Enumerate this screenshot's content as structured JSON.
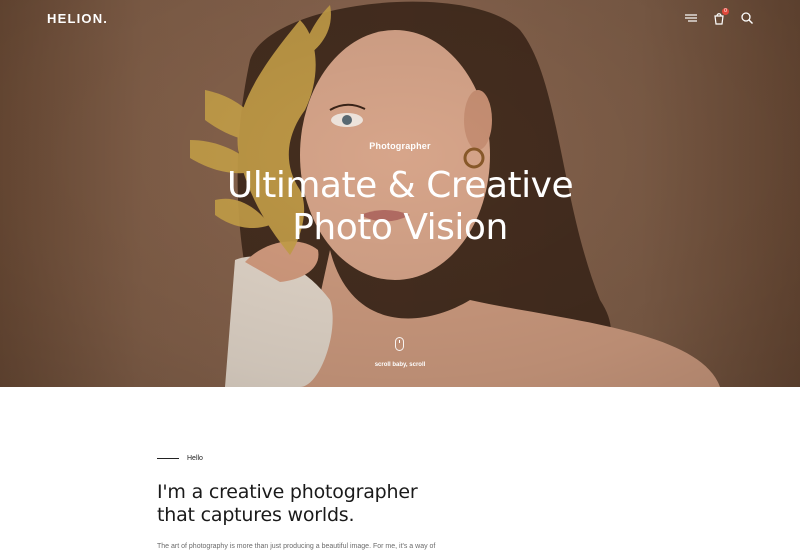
{
  "header": {
    "logo": "HELION.",
    "cart_count": "0",
    "icons": [
      "menu-icon",
      "cart-icon",
      "search-icon"
    ]
  },
  "hero": {
    "subtitle": "Photographer",
    "title_line1": "Ultimate & Creative",
    "title_line2": "Photo Vision",
    "scroll_label": "scroll baby, scroll"
  },
  "about": {
    "eyebrow": "Hello",
    "heading_line1": "I'm a creative photographer",
    "heading_line2": "that captures worlds.",
    "body": "The art of photography is more than just producing a beautiful image. For me, it's a way of"
  },
  "colors": {
    "hero_bg": "#84614a",
    "accent_badge": "#e2483b",
    "text_dark": "#1a1a1a",
    "text_muted": "#6b6b6b"
  }
}
